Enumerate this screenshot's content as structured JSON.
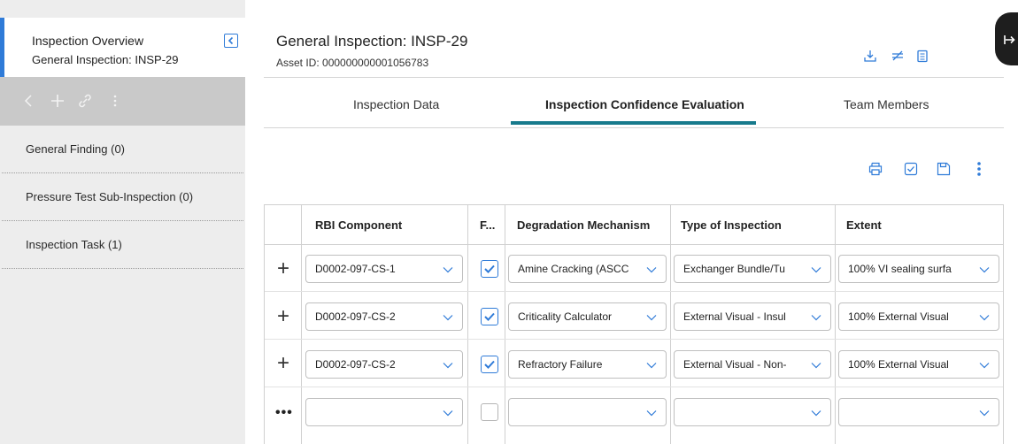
{
  "sidebar": {
    "title": "Inspection Overview",
    "subtitle": "General Inspection: INSP-29",
    "items": [
      {
        "label": "General Finding (0)"
      },
      {
        "label": "Pressure Test Sub-Inspection (0)"
      },
      {
        "label": "Inspection Task (1)"
      }
    ]
  },
  "header": {
    "title": "General Inspection: INSP-29",
    "asset": "Asset ID: 000000000001056783"
  },
  "tabs": [
    {
      "label": "Inspection Data"
    },
    {
      "label": "Inspection Confidence Evaluation"
    },
    {
      "label": "Team Members"
    }
  ],
  "grid": {
    "columns": [
      "RBI Component",
      "F...",
      "Degradation Mechanism",
      "Type of Inspection",
      "Extent"
    ],
    "rows": [
      {
        "component": "D0002-097-CS-1",
        "checked": true,
        "mechanism": "Amine Cracking (ASCC",
        "type": "Exchanger Bundle/Tu",
        "extent": "100% VI sealing surfa"
      },
      {
        "component": "D0002-097-CS-2",
        "checked": true,
        "mechanism": "Criticality Calculator",
        "type": "External Visual - Insul",
        "extent": "100% External Visual"
      },
      {
        "component": "D0002-097-CS-2",
        "checked": true,
        "mechanism": "Refractory Failure",
        "type": "External Visual - Non-",
        "extent": "100% External Visual"
      },
      {
        "component": "",
        "checked": false,
        "mechanism": "",
        "type": "",
        "extent": ""
      }
    ],
    "new_row_marker": "•••"
  },
  "colors": {
    "accent": "#2f7bd8",
    "tab_indicator": "#177a8c",
    "sidebar_bg": "#ededed",
    "toolbar_bg": "#c9c9c9"
  }
}
